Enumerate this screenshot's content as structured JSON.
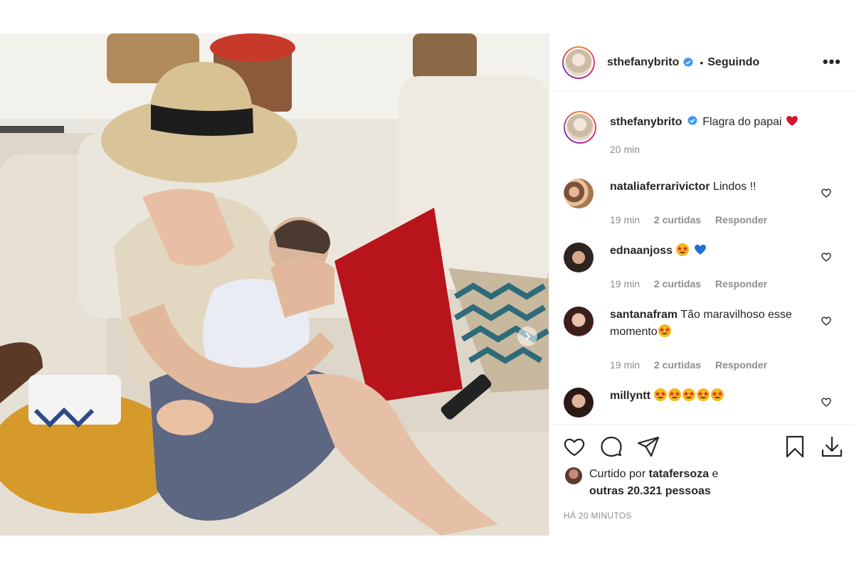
{
  "post": {
    "username": "sthefanybrito",
    "follow_status": "Seguindo",
    "separator": "•",
    "more_icon": "more-options-icon",
    "caption": {
      "username": "sthefanybrito",
      "text": "Flagra do papai",
      "emoji": "red-heart",
      "time": "20 min"
    },
    "comments": [
      {
        "username": "nataliaferrarivictor",
        "text": "Lindos !!",
        "time": "19 min",
        "likes": "2 curtidas",
        "reply": "Responder"
      },
      {
        "username": "ednaanjoss",
        "text": "",
        "emojis": [
          "star-struck",
          "blue-heart"
        ],
        "time": "19 min",
        "likes": "2 curtidas",
        "reply": "Responder"
      },
      {
        "username": "santanafram",
        "text": "Tão maravilhoso esse momento",
        "emojis": [
          "star-struck"
        ],
        "time": "19 min",
        "likes": "2 curtidas",
        "reply": "Responder"
      },
      {
        "username": "millyntt",
        "text": "",
        "emojis": [
          "star-struck",
          "star-struck",
          "star-struck",
          "star-struck",
          "star-struck"
        ]
      }
    ],
    "liked_by": {
      "prefix": "Curtido por",
      "user": "tatafersoza",
      "conj": "e",
      "others": "outras 20.321 pessoas"
    },
    "timestamp": "HÁ 20 MINUTOS"
  },
  "colors": {
    "verified": "#3897f0",
    "heart_red": "#ed4956",
    "meta_gray": "#8e8e8e",
    "border": "#efefef"
  }
}
